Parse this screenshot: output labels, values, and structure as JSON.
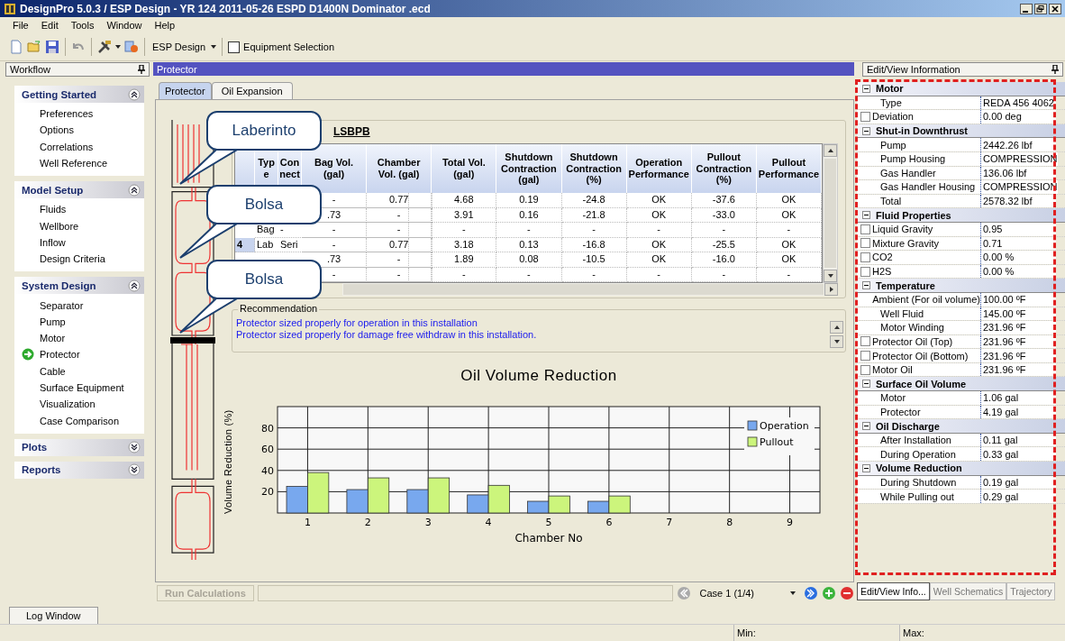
{
  "window": {
    "title": "DesignPro 5.0.3 / ESP Design - YR 124 2011-05-26 ESPD D1400N Dominator .ecd"
  },
  "menu": [
    "File",
    "Edit",
    "Tools",
    "Window",
    "Help"
  ],
  "toolbar": {
    "design_dropdown": "ESP Design",
    "equipment_selection": {
      "label": "Equipment Selection",
      "checked": false
    }
  },
  "workflow": {
    "title": "Workflow",
    "groups": [
      {
        "title": "Getting Started",
        "expanded": true,
        "items": [
          {
            "label": "Preferences",
            "selected": false
          },
          {
            "label": "Options",
            "selected": false
          },
          {
            "label": "Correlations",
            "selected": false
          },
          {
            "label": "Well Reference",
            "selected": false
          }
        ]
      },
      {
        "title": "Model Setup",
        "expanded": true,
        "items": [
          {
            "label": "Fluids",
            "selected": false
          },
          {
            "label": "Wellbore",
            "selected": false
          },
          {
            "label": "Inflow",
            "selected": false
          },
          {
            "label": "Design Criteria",
            "selected": false
          }
        ]
      },
      {
        "title": "System Design",
        "expanded": true,
        "items": [
          {
            "label": "Separator",
            "selected": false
          },
          {
            "label": "Pump",
            "selected": false
          },
          {
            "label": "Motor",
            "selected": false
          },
          {
            "label": "Protector",
            "selected": true
          },
          {
            "label": "Cable",
            "selected": false
          },
          {
            "label": "Surface Equipment",
            "selected": false
          },
          {
            "label": "Visualization",
            "selected": false
          },
          {
            "label": "Case Comparison",
            "selected": false
          }
        ]
      },
      {
        "title": "Plots",
        "expanded": false
      },
      {
        "title": "Reports",
        "expanded": false
      }
    ]
  },
  "panel_title": "Protector",
  "tabs": [
    {
      "label": "Protector",
      "selected": false
    },
    {
      "label": "Oil Expansion",
      "selected": true
    }
  ],
  "callouts": [
    "Laberinto",
    "Bolsa",
    "Bolsa"
  ],
  "table": {
    "caption": "LSBPB",
    "columns": [
      "Type",
      "Connect",
      "Bag Vol. (gal)",
      "Chamber Vol. (gal)",
      "Total Vol. (gal)",
      "Shutdown Contraction (gal)",
      "Shutdown Contraction (%)",
      "Operation Performance",
      "Pullout Contraction (%)",
      "Pullout Performance"
    ],
    "rows": [
      {
        "values": [
          "-",
          "0.77",
          "4.68",
          "0.19",
          "-24.8",
          "OK",
          "-37.6",
          "OK"
        ]
      },
      {
        "values": [
          ".73",
          "-",
          "3.91",
          "0.16",
          "-21.8",
          "OK",
          "-33.0",
          "OK"
        ]
      },
      {
        "type": "Bag",
        "connect": "-",
        "values": [
          "-",
          "-",
          "-",
          "-",
          "-",
          "-",
          "-",
          "-"
        ]
      },
      {
        "number": "4",
        "type": "Lab",
        "connect": "Seri",
        "values": [
          "-",
          "0.77",
          "3.18",
          "0.13",
          "-16.8",
          "OK",
          "-25.5",
          "OK"
        ]
      },
      {
        "values": [
          ".73",
          "-",
          "1.89",
          "0.08",
          "-10.5",
          "OK",
          "-16.0",
          "OK"
        ]
      },
      {
        "values": [
          "-",
          "-",
          "-",
          "-",
          "-",
          "-",
          "-",
          "-"
        ]
      }
    ]
  },
  "recommendation": {
    "title": "Recommendation",
    "lines": [
      "Protector sized properly for operation in this installation",
      "Protector sized properly for damage free withdraw in this installation."
    ]
  },
  "chart_data": {
    "type": "bar",
    "title": "Oil Volume Reduction",
    "xlabel": "Chamber No",
    "ylabel": "Volume Reduction (%)",
    "categories": [
      "1",
      "2",
      "3",
      "4",
      "5",
      "6",
      "7",
      "8",
      "9"
    ],
    "ylim": [
      0,
      100
    ],
    "yticks": [
      20,
      40,
      60,
      80
    ],
    "grid": true,
    "legend": true,
    "series": [
      {
        "name": "Operation",
        "color": "#78a8ee",
        "values": [
          25,
          22,
          22,
          17,
          11,
          11,
          null,
          null,
          null
        ]
      },
      {
        "name": "Pullout",
        "color": "#ccf57c",
        "values": [
          38,
          33,
          33,
          26,
          16,
          16,
          null,
          null,
          null
        ]
      }
    ]
  },
  "bottom_bar": {
    "run_button": {
      "label": "Run Calculations",
      "disabled": true
    },
    "case": "Case 1 (1/4)"
  },
  "info_panel": {
    "title": "Edit/View Information",
    "sections": [
      {
        "title": "Motor",
        "rows": [
          {
            "kind": "plain",
            "name": "Type",
            "value": "REDA 456 4062"
          },
          {
            "kind": "check",
            "checked": false,
            "name": "Deviation",
            "value": "0.00 deg"
          }
        ]
      },
      {
        "title": "Shut-in Downthrust",
        "rows": [
          {
            "kind": "plain",
            "name": "Pump",
            "value": "2442.26 lbf"
          },
          {
            "kind": "plain",
            "name": "Pump Housing",
            "value": "COMPRESSION"
          },
          {
            "kind": "plain",
            "name": "Gas Handler",
            "value": "136.06 lbf"
          },
          {
            "kind": "plain",
            "name": "Gas Handler Housing",
            "value": "COMPRESSION"
          },
          {
            "kind": "plain",
            "name": "Total",
            "value": "2578.32 lbf"
          }
        ]
      },
      {
        "title": "Fluid Properties",
        "rows": [
          {
            "kind": "check",
            "checked": false,
            "name": "Liquid Gravity",
            "value": "0.95"
          },
          {
            "kind": "check",
            "checked": false,
            "name": "Mixture Gravity",
            "value": "0.71"
          },
          {
            "kind": "check",
            "checked": false,
            "name": "CO2",
            "value": "0.00 %"
          },
          {
            "kind": "check",
            "checked": false,
            "name": "H2S",
            "value": "0.00 %"
          }
        ]
      },
      {
        "title": "Temperature",
        "rows": [
          {
            "kind": "plain",
            "name": "Ambient (For oil volume)",
            "value": "100.00 ºF"
          },
          {
            "kind": "plain",
            "name": "Well Fluid",
            "value": "145.00 ºF"
          },
          {
            "kind": "plain",
            "name": "Motor Winding",
            "value": "231.96 ºF"
          },
          {
            "kind": "check",
            "checked": false,
            "name": "Protector Oil (Top)",
            "value": "231.96 ºF"
          },
          {
            "kind": "check",
            "checked": false,
            "name": "Protector Oil (Bottom)",
            "value": "231.96 ºF"
          },
          {
            "kind": "check",
            "checked": false,
            "name": "Motor Oil",
            "value": "231.96 ºF"
          }
        ]
      },
      {
        "title": "Surface Oil Volume",
        "rows": [
          {
            "kind": "plain",
            "name": "Motor",
            "value": "1.06 gal"
          },
          {
            "kind": "plain",
            "name": "Protector",
            "value": "4.19 gal"
          }
        ]
      },
      {
        "title": "Oil Discharge",
        "rows": [
          {
            "kind": "plain",
            "name": "After Installation",
            "value": "0.11 gal"
          },
          {
            "kind": "plain",
            "name": "During Operation",
            "value": "0.33 gal"
          }
        ]
      },
      {
        "title": "Volume Reduction",
        "rows": [
          {
            "kind": "plain",
            "name": "During Shutdown",
            "value": "0.19 gal"
          },
          {
            "kind": "plain",
            "name": "While Pulling out",
            "value": "0.29 gal"
          }
        ]
      }
    ],
    "tabs": [
      {
        "label": "Edit/View  Info...",
        "selected": true
      },
      {
        "label": "Well Schematics",
        "selected": false
      },
      {
        "label": "Trajectory",
        "selected": false
      }
    ]
  },
  "log_tab": "Log Window",
  "status_bar": [
    "Min:",
    "Max:"
  ]
}
